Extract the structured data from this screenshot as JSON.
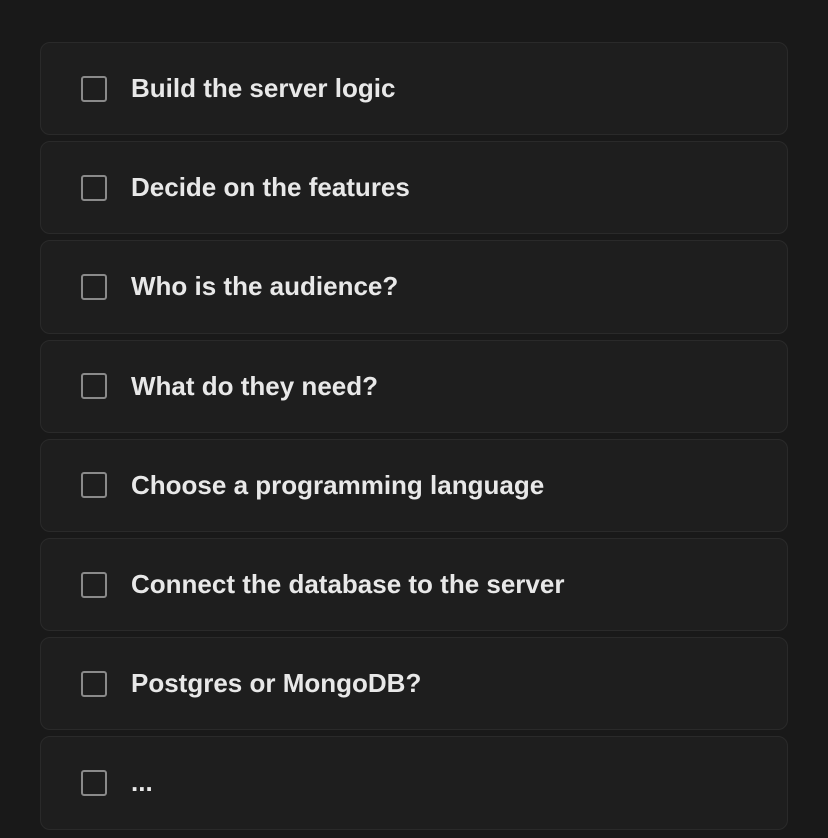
{
  "tasks": [
    {
      "id": "build-server-logic",
      "label": "Build the server logic",
      "checked": false
    },
    {
      "id": "decide-features",
      "label": "Decide on the features",
      "checked": false
    },
    {
      "id": "audience",
      "label": "Who is the audience?",
      "checked": false
    },
    {
      "id": "needs",
      "label": "What do they need?",
      "checked": false
    },
    {
      "id": "choose-language",
      "label": "Choose a programming language",
      "checked": false
    },
    {
      "id": "connect-database",
      "label": "Connect the database to the server",
      "checked": false
    },
    {
      "id": "db-choice",
      "label": "Postgres or MongoDB?",
      "checked": false
    },
    {
      "id": "more",
      "label": "...",
      "checked": false
    }
  ]
}
